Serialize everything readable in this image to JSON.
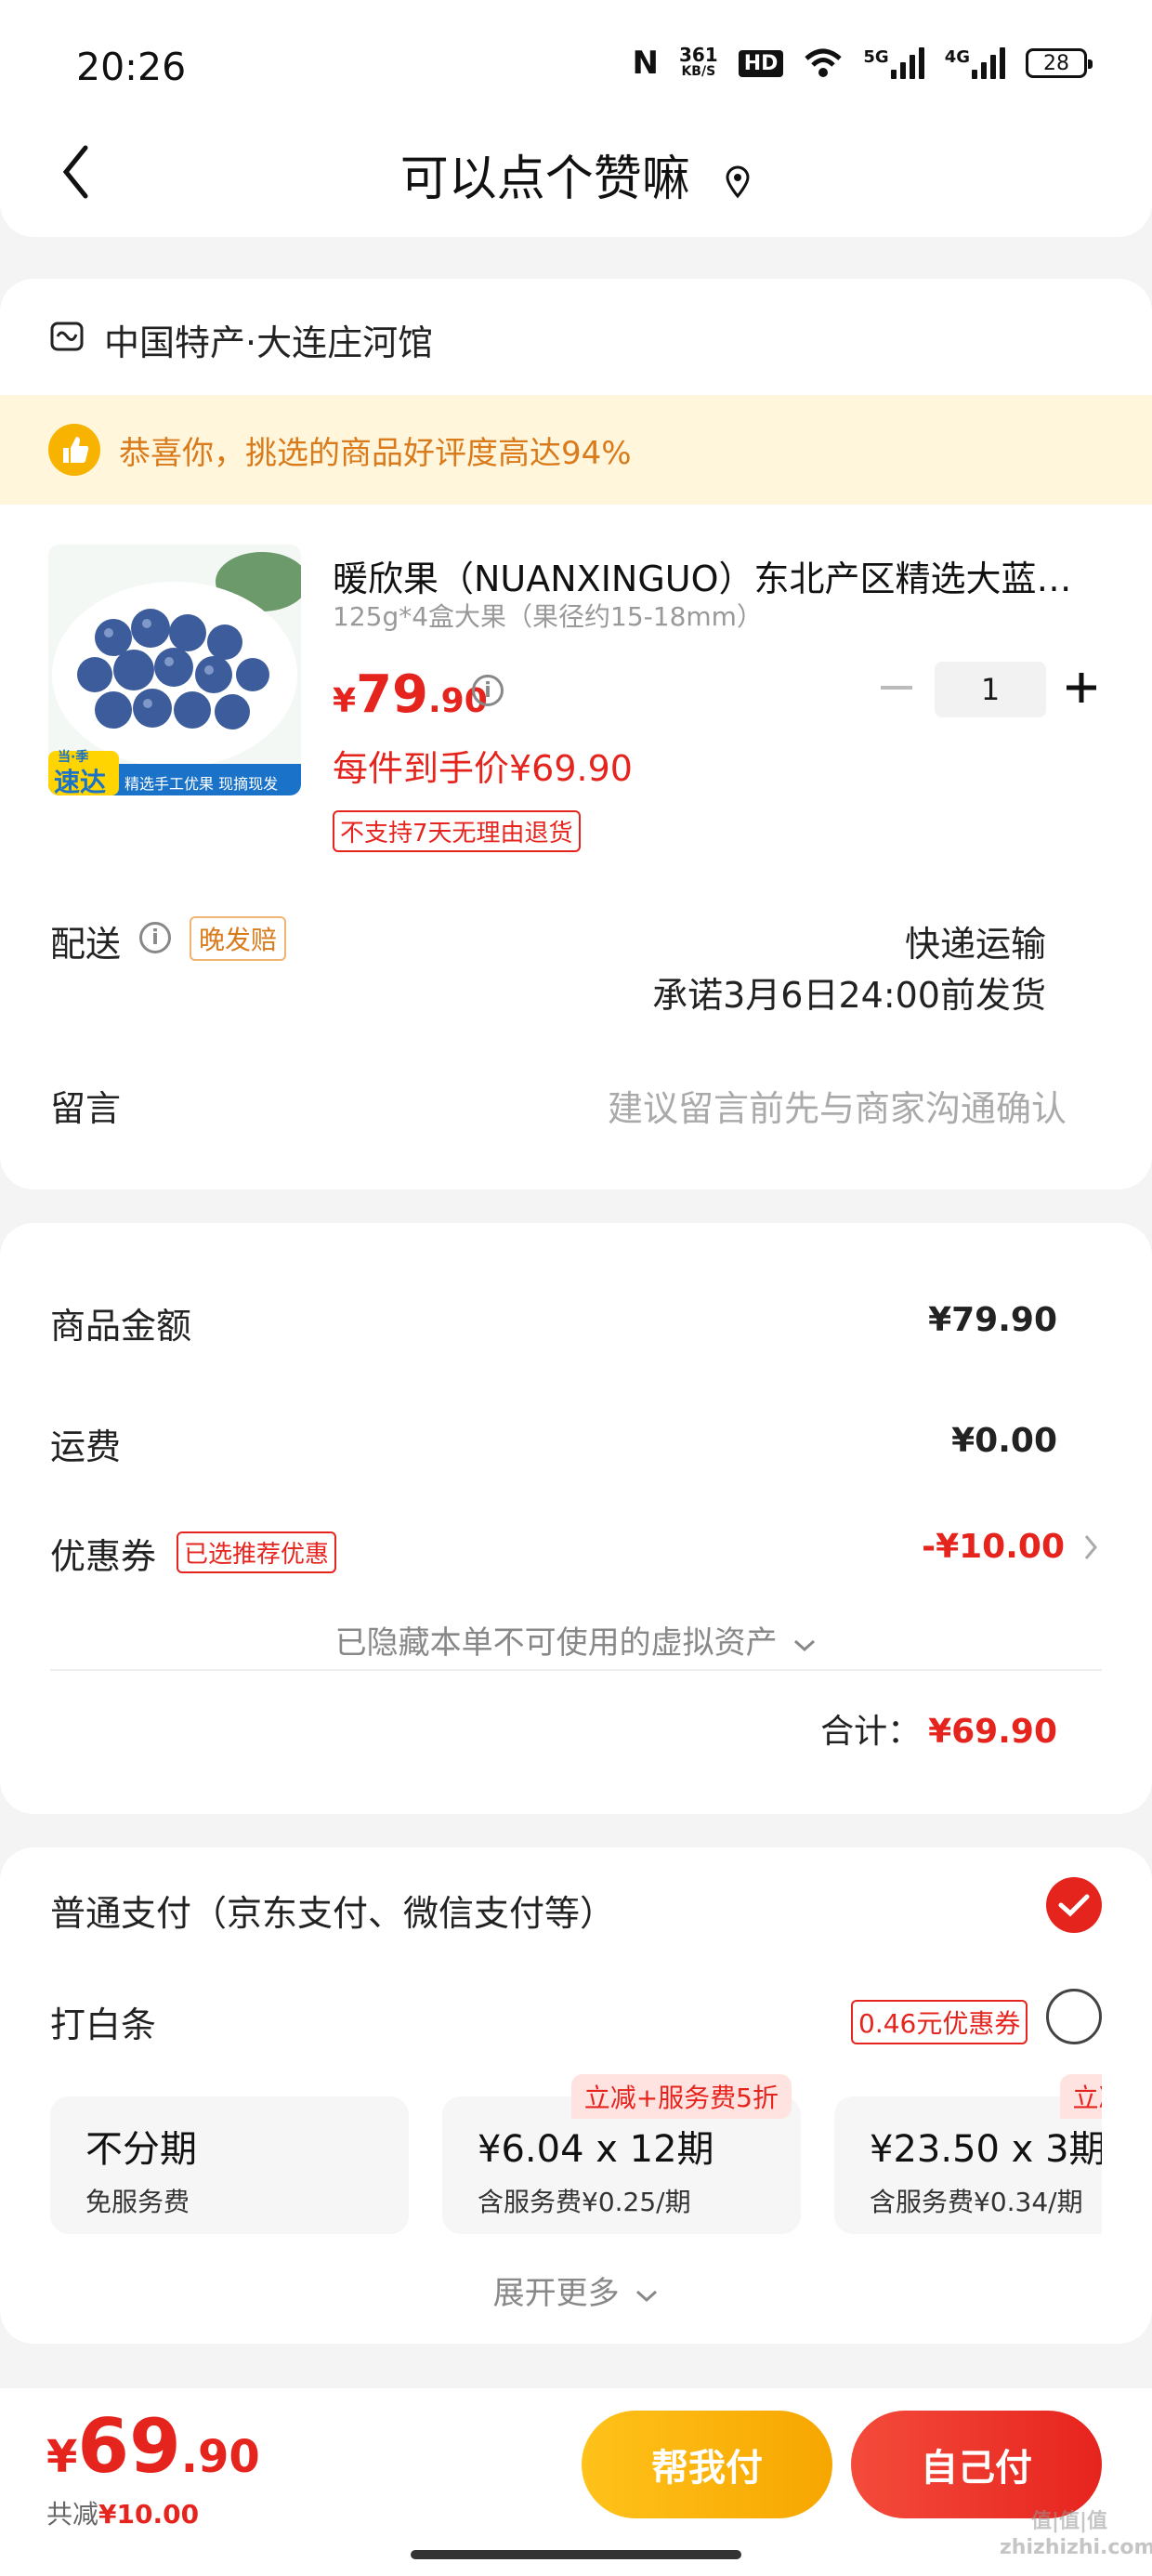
{
  "status_bar": {
    "time": "20:26",
    "net_speed_top": "361",
    "net_speed_bottom": "KB/S",
    "hd": "HD",
    "net1": "5G",
    "net2": "4G",
    "battery": "28"
  },
  "nav": {
    "title": "可以点个赞嘛"
  },
  "shop": {
    "name": "中国特产·大连庄河馆"
  },
  "banner": {
    "text": "恭喜你，挑选的商品好评度高达94%"
  },
  "product": {
    "name": "暖欣果（NUANXINGUO）东北产区精选大蓝莓…",
    "spec": "125g*4盒大果（果径约15-18mm）",
    "thumb_badge": "速达",
    "thumb_badge_top": "当·季",
    "thumb_caption": "精选手工优果 现摘现发",
    "price_symbol": "¥",
    "price_int": "79",
    "price_dec": ".90",
    "quantity": "1",
    "final_price": "每件到手价¥69.90",
    "return_tag": "不支持7天无理由退货"
  },
  "delivery": {
    "label": "配送",
    "tag": "晚发赔",
    "method": "快递运输",
    "promise": "承诺3月6日24:00前发货"
  },
  "message": {
    "label": "留言",
    "placeholder": "建议留言前先与商家沟通确认"
  },
  "summary": {
    "goods_label": "商品金额",
    "goods_value": "¥79.90",
    "shipping_label": "运费",
    "shipping_value": "¥0.00",
    "coupon_label": "优惠券",
    "coupon_tag": "已选推荐优惠",
    "coupon_value": "-¥10.00",
    "hidden_assets": "已隐藏本单不可使用的虚拟资产",
    "total_label": "合计：",
    "total_value": "¥69.90"
  },
  "payment": {
    "normal_label": "普通支付（京东支付、微信支付等）",
    "baitiao_label": "打白条",
    "baitiao_coupon": "0.46元优惠券",
    "plans": [
      {
        "title": "不分期",
        "sub": "免服务费",
        "tag": ""
      },
      {
        "title": "¥6.04 x 12期",
        "sub": "含服务费¥0.25/期",
        "tag": "立减+服务费5折"
      },
      {
        "title": "¥23.50 x 3期",
        "sub": "含服务费¥0.34/期",
        "tag": "立减+服务"
      }
    ],
    "expand": "展开更多"
  },
  "footer": {
    "price_symbol": "¥",
    "price_int": "69",
    "price_dec": ".90",
    "saved_label": "共减",
    "saved_value": "¥10.00",
    "help_pay": "帮我付",
    "self_pay": "自己付"
  },
  "watermark": "值|值|值 zhizhizhi.com",
  "colors": {
    "accent_red": "#e6241e",
    "accent_gold": "#f7b300",
    "banner_bg": "#fff6dc"
  }
}
